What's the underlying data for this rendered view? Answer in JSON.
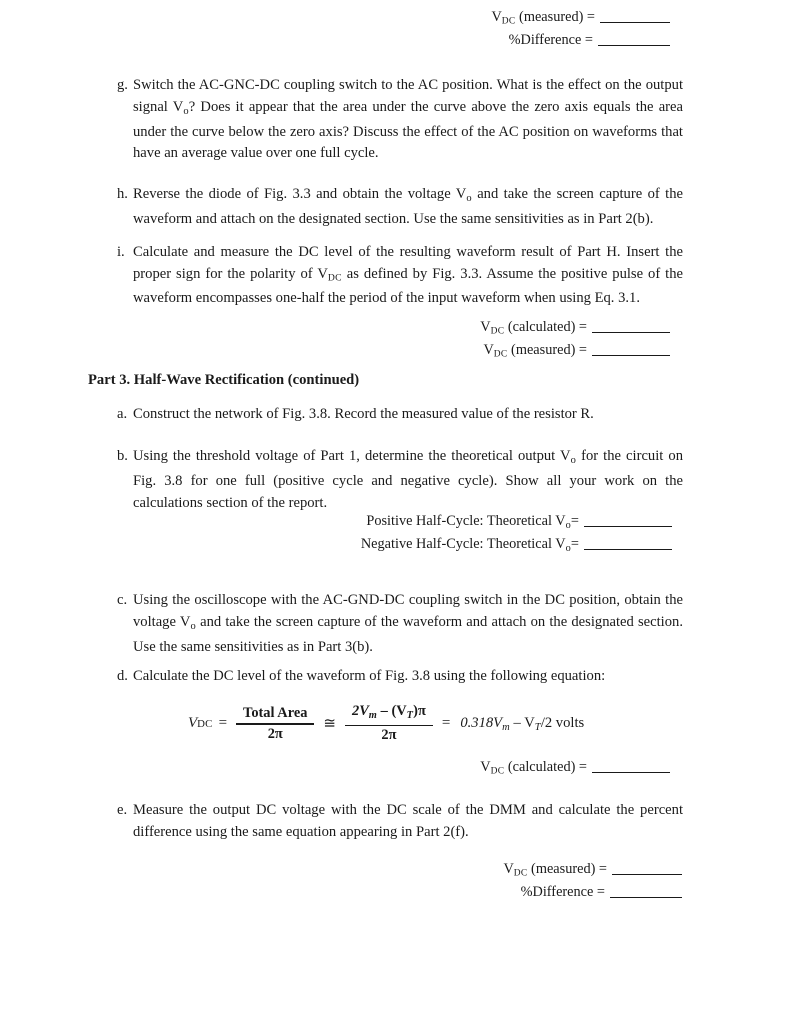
{
  "document": {
    "type": "lab-manual-worksheet-page",
    "page_background": "#ffffff",
    "text_color": "#1a1a1a"
  },
  "top_answers": {
    "lines": [
      {
        "label_pre": "V",
        "label_sub": "DC",
        "label_post": " (measured) ="
      },
      {
        "label_pre": "",
        "label_sub": "",
        "label_post": "%Difference ="
      }
    ],
    "line1_text": "V",
    "line1_sub": "DC",
    "line1_rest": " (measured) =",
    "line2_text": "%Difference ="
  },
  "item_g": {
    "marker": "g.",
    "text_part1": "Switch the AC-GNC-DC coupling switch to the AC position. What is the effect on the output signal V",
    "text_sub1": "o",
    "text_part2": "? Does it appear that the area under the curve above the zero axis equals the area under the curve below the zero axis? Discuss the effect of the AC position on waveforms that have an average value over one full cycle."
  },
  "item_h": {
    "marker": "h.",
    "text_part1": "Reverse the diode of Fig. 3.3 and obtain the voltage V",
    "text_sub1": "o",
    "text_part2": " and take the screen capture of the waveform and attach on the designated section. Use the same sensitivities as in Part 2(b)."
  },
  "item_i": {
    "marker": "i.",
    "text_part1": "Calculate and measure the DC level of the resulting waveform result of Part H. Insert the proper sign for the polarity of V",
    "text_sub1": "DC",
    "text_part2": " as defined by Fig. 3.3. Assume the positive pulse of the waveform encompasses one-half the period of the input waveform when using Eq. 3.1."
  },
  "answers_after_i": {
    "line1_pre": "V",
    "line1_sub": "DC",
    "line1_post": " (calculated) =",
    "line2_pre": "V",
    "line2_sub": "DC",
    "line2_post": " (measured) ="
  },
  "part3_heading": {
    "text": "Part 3. Half-Wave Rectification (continued)"
  },
  "item_a": {
    "marker": "a.",
    "text": "Construct the network of Fig. 3.8. Record the measured value of the resistor R."
  },
  "item_b": {
    "marker": "b.",
    "text_part1": "Using the threshold voltage of Part 1, determine the theoretical output V",
    "text_sub1": "o",
    "text_part2": " for the circuit on Fig. 3.8 for one full (positive cycle and negative cycle). Show all your work on the calculations section of the report."
  },
  "half_cycle_answers": {
    "line1_pre": "Positive Half-Cycle: Theoretical V",
    "line1_sub": "o",
    "line1_post": "=",
    "line2_pre": "Negative Half-Cycle: Theoretical V",
    "line2_sub": "o",
    "line2_post": "="
  },
  "item_c": {
    "marker": "c.",
    "text_part1": "Using the oscilloscope with the AC-GND-DC coupling switch in the DC position, obtain the voltage V",
    "text_sub1": "o",
    "text_part2": " and take the screen capture of the waveform and attach on the designated section. Use the same sensitivities as in Part 3(b)."
  },
  "item_d": {
    "marker": "d.",
    "text": "Calculate the DC level of the waveform of Fig. 3.8 using the following equation:"
  },
  "equation": {
    "lhs_var": "V",
    "lhs_sub": "DC",
    "equals": "=",
    "frac1_num": "Total Area",
    "frac1_den": "2π",
    "approx": "≅",
    "frac2_num_a": "2V",
    "frac2_num_a_sub": "m",
    "frac2_num_b": " – (V",
    "frac2_num_b_sub": "T",
    "frac2_num_c": ")π",
    "frac2_den": "2π",
    "equals2": "=",
    "result_a": "0.318V",
    "result_a_sub": "m",
    "result_b": " – V",
    "result_b_sub": "T",
    "result_c": "/2 volts"
  },
  "answer_after_d": {
    "line1_pre": "V",
    "line1_sub": "DC",
    "line1_post": " (calculated) ="
  },
  "item_e": {
    "marker": "e.",
    "text": "Measure the output DC voltage with the DC scale of the DMM and calculate the percent difference using the same equation appearing in Part 2(f)."
  },
  "bottom_answers": {
    "line1_pre": "V",
    "line1_sub": "DC",
    "line1_post": " (measured) =",
    "line2_text": "%Difference ="
  }
}
